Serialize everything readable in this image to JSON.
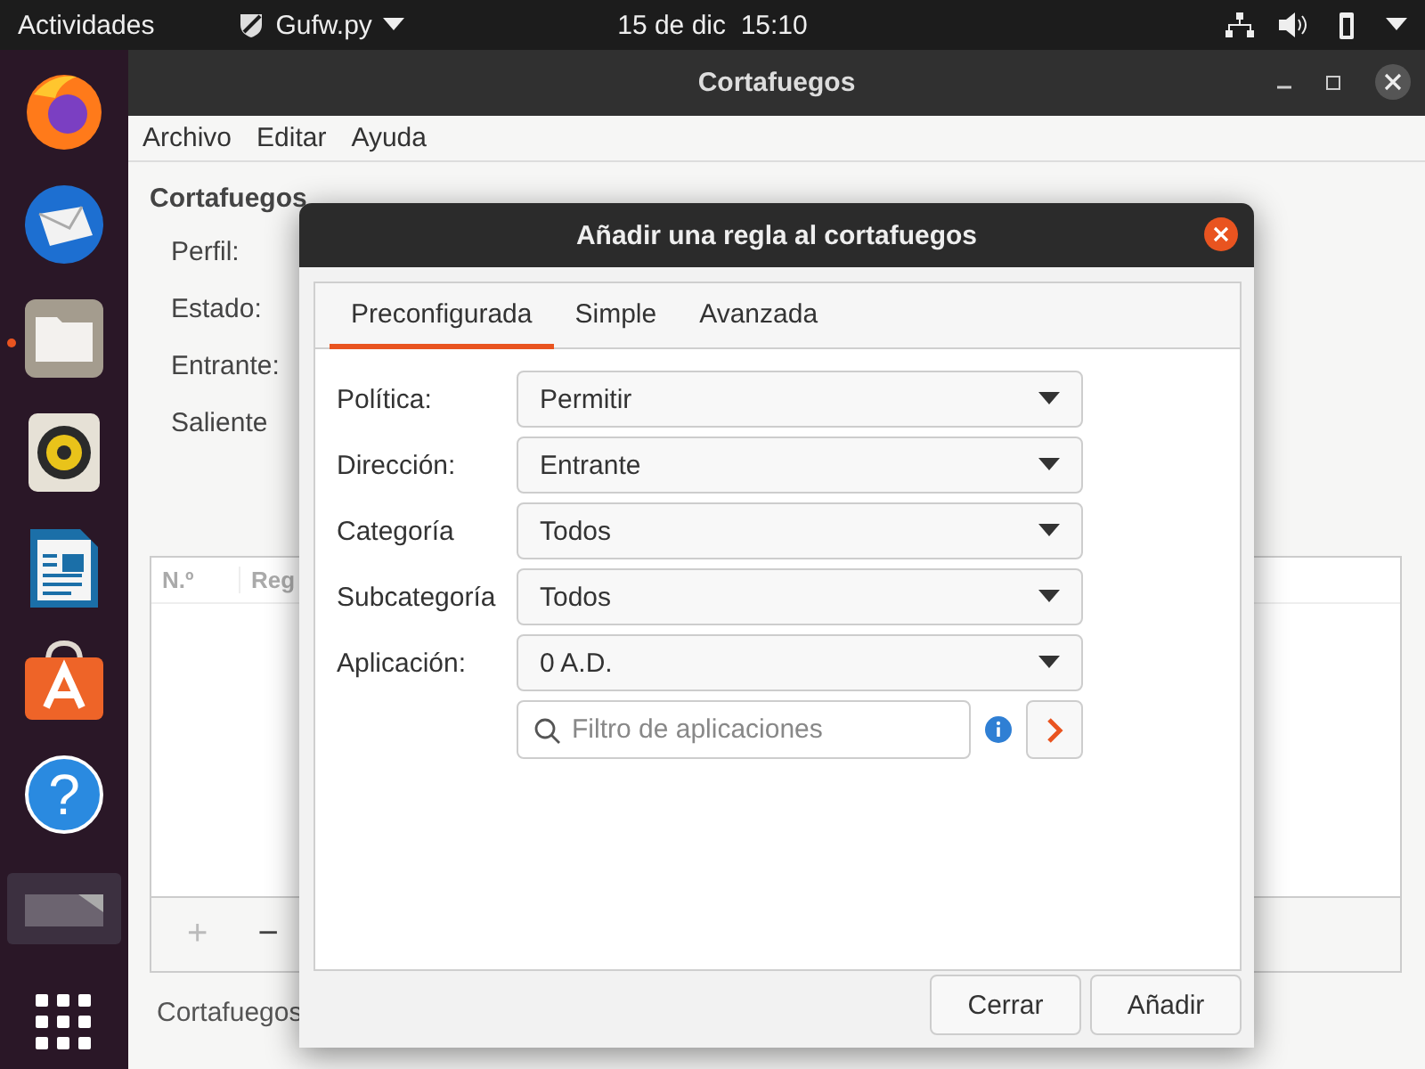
{
  "top_bar": {
    "activities": "Actividades",
    "app_menu": "Gufw.py",
    "clock": "15 de dic  15:10"
  },
  "dock": {
    "items": [
      {
        "kind": "browser",
        "running": false
      },
      {
        "kind": "mail",
        "running": false
      },
      {
        "kind": "files",
        "running": true
      },
      {
        "kind": "music",
        "running": false
      },
      {
        "kind": "writer",
        "running": false
      },
      {
        "kind": "store",
        "running": false
      },
      {
        "kind": "help",
        "running": false,
        "glyph": "?"
      },
      {
        "kind": "thumbnail",
        "running": false
      },
      {
        "kind": "grid",
        "running": false
      }
    ]
  },
  "window": {
    "title": "Cortafuegos",
    "menu": [
      "Archivo",
      "Editar",
      "Ayuda"
    ],
    "section_title": "Cortafuegos",
    "fields": [
      "Perfil:",
      "Estado:",
      "Entrante:",
      "Saliente"
    ],
    "table": {
      "columns": [
        "N.º",
        "Reg"
      ]
    },
    "toolbar": [
      "+",
      "−"
    ],
    "status_bar": "Cortafuegos"
  },
  "dialog": {
    "title": "Añadir una regla al cortafuegos",
    "tabs": [
      {
        "label": "Preconfigurada",
        "selected": true
      },
      {
        "label": "Simple",
        "selected": false
      },
      {
        "label": "Avanzada",
        "selected": false
      }
    ],
    "form": [
      {
        "label": "Política:",
        "value": "Permitir"
      },
      {
        "label": "Dirección:",
        "value": "Entrante"
      },
      {
        "label": "Categoría",
        "value": "Todos"
      },
      {
        "label": "Subcategoría",
        "value": "Todos"
      },
      {
        "label": "Aplicación:",
        "value": "0 A.D."
      }
    ],
    "filter": {
      "placeholder": "Filtro de aplicaciones"
    },
    "buttons": [
      "Cerrar",
      "Añadir"
    ]
  }
}
